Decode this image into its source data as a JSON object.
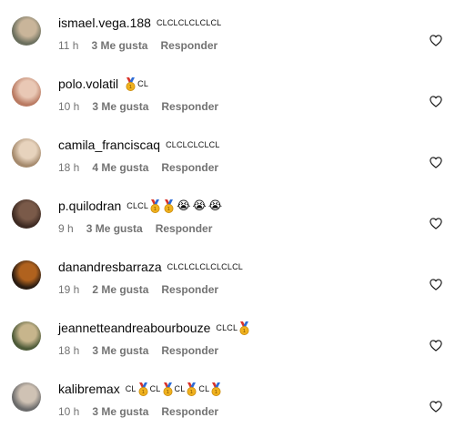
{
  "comments": [
    {
      "username": "ismael.vega.188",
      "text": "CLCLCLCLCLCL",
      "emoji": [],
      "time": "11 h",
      "likes": "3 Me gusta",
      "reply": "Responder",
      "avatar_colors": [
        "#6b6f5e",
        "#c9b59a"
      ]
    },
    {
      "username": "polo.volatil",
      "text": "CL",
      "emoji": [
        "medal"
      ],
      "emoji_first": true,
      "time": "10 h",
      "likes": "3 Me gusta",
      "reply": "Responder",
      "avatar_colors": [
        "#b97a62",
        "#e9c8b5"
      ]
    },
    {
      "username": "camila_franciscaq",
      "text": "CLCLCLCLCL",
      "emoji": [],
      "time": "18 h",
      "likes": "4 Me gusta",
      "reply": "Responder",
      "avatar_colors": [
        "#a58a6d",
        "#e7d3bd"
      ]
    },
    {
      "username": "p.quilodran",
      "text": "CLCL",
      "emoji": [
        "medal",
        "medal",
        "😭",
        "😭",
        "😭"
      ],
      "time": "9 h",
      "likes": "3 Me gusta",
      "reply": "Responder",
      "avatar_colors": [
        "#3d2a22",
        "#7a5a49"
      ]
    },
    {
      "username": "danandresbarraza",
      "text": "CLCLCLCLCLCLCL",
      "emoji": [],
      "time": "19 h",
      "likes": "2 Me gusta",
      "reply": "Responder",
      "avatar_colors": [
        "#2a1c12",
        "#b0621e"
      ]
    },
    {
      "username": "jeannetteandreabourbouze",
      "text": "CLCL",
      "emoji": [
        "medal"
      ],
      "time": "18 h",
      "likes": "3 Me gusta",
      "reply": "Responder",
      "avatar_colors": [
        "#4d5a38",
        "#c7b58c"
      ]
    },
    {
      "username": "kalibremax",
      "text_segments": [
        "CL",
        "CL",
        "CL",
        "CL"
      ],
      "emoji": [
        "medal",
        "medal",
        "medal",
        "medal"
      ],
      "time": "10 h",
      "likes": "3 Me gusta",
      "reply": "Responder",
      "avatar_colors": [
        "#6a6a6a",
        "#cfc2b4"
      ]
    }
  ],
  "icons": {
    "like": "heart-outline-icon",
    "medal": "first-place-medal-icon"
  },
  "colors": {
    "meta": "#737373",
    "text": "#0a0a0a"
  }
}
